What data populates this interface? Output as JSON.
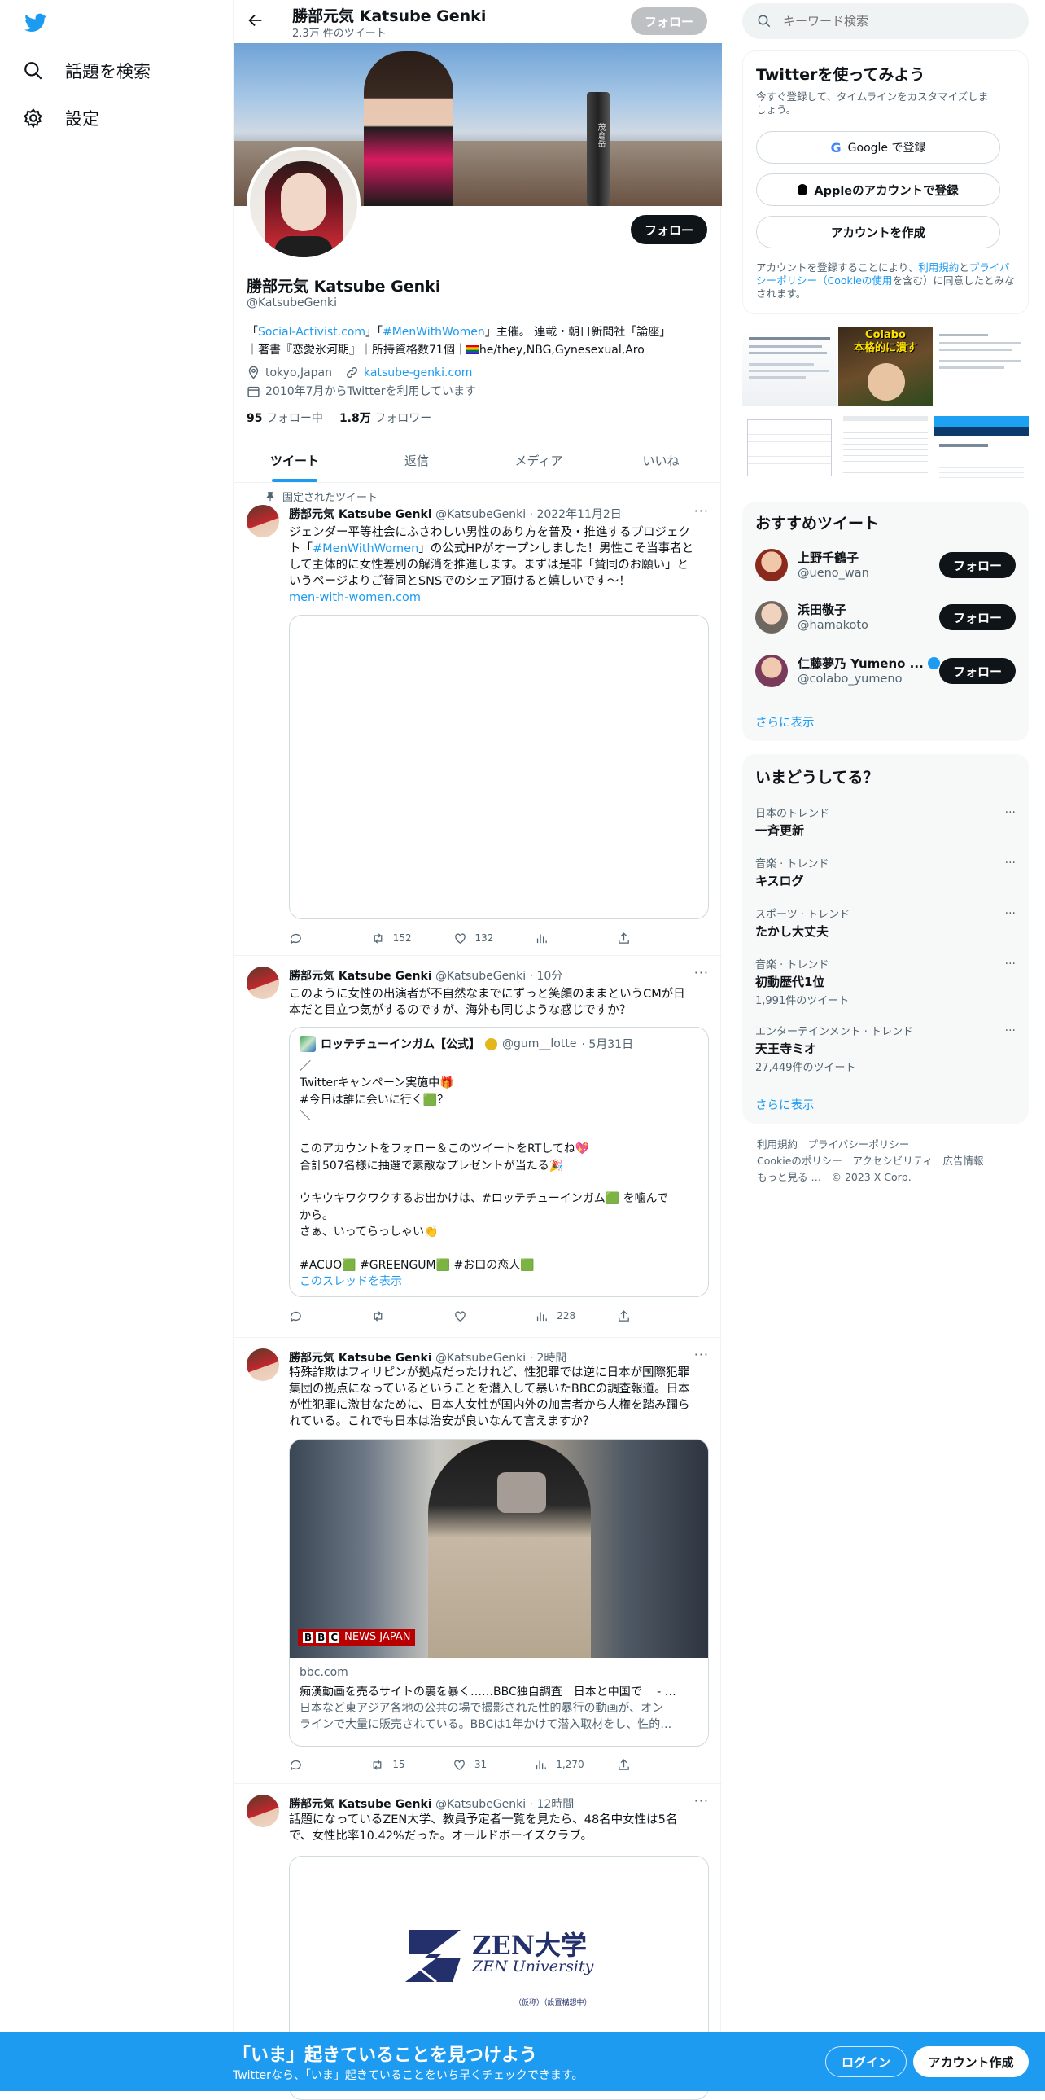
{
  "nav": {
    "explore_label": "話題を検索",
    "settings_label": "設定"
  },
  "header": {
    "name": "勝部元気 Katsube Genki",
    "tweet_count": "2.3万 件のツイート",
    "follow_label": "フォロー"
  },
  "profile": {
    "name": "勝部元気 Katsube Genki",
    "handle": "@KatsubeGenki",
    "bio_prefix": "「",
    "bio_link1": "Social-Activist.com",
    "bio_mid1": "」「",
    "bio_link2": "#MenWithWomen",
    "bio_rest1": "」主催。 連載・朝日新聞社「論座」",
    "bio_line2_a": "｜著書『恋愛氷河期』｜所持資格数71個｜",
    "bio_line2_b": "he/they,NBG,Gynesexual,Aro",
    "location": "tokyo,Japan",
    "website": "katsube-genki.com",
    "joined": "2010年7月からTwitterを利用しています",
    "following_count": "95",
    "following_label": "フォロー中",
    "followers_count": "1.8万",
    "followers_label": "フォロワー",
    "follow_label": "フォロー",
    "summit_sign": "茂倉岳"
  },
  "tabs": [
    "ツイート",
    "返信",
    "メディア",
    "いいね"
  ],
  "pinned_label": "固定されたツイート",
  "tweets": [
    {
      "name": "勝部元気 Katsube Genki",
      "handle": "@KatsubeGenki",
      "time": "· 2022年11月2日",
      "text_a": "ジェンダー平等社会にふさわしい男性のあり方を普及・推進するプロジェク\nト「",
      "text_link": "#MenWithWomen",
      "text_b": "」の公式HPがオープンしました！男性こそ当事者と\nして主体的に女性差別の解消を推進します。まずは是非「賛同のお願い」と\nいうページよりご賛同とSNSでのシェア頂けると嬉しいです〜！",
      "url": "men-with-women.com",
      "reply": "",
      "retweet": "152",
      "like": "132",
      "views": ""
    },
    {
      "name": "勝部元気 Katsube Genki",
      "handle": "@KatsubeGenki",
      "time": "· 10分",
      "text": "このように女性の出演者が不自然なまでにずっと笑顔のままというCMが日\n本だと目立つ気がするのですが、海外も同じような感じですか？",
      "quote": {
        "name": "ロッテチューインガム【公式】",
        "handle": "@gum__lotte",
        "time": "· 5月31日",
        "text": "／\nTwitterキャンペーン実施中🎁\n#今日は誰に会いに行く🟩？\n＼\n\nこのアカウントをフォロー＆このツイートをRTしてね💖\n合計507名様に抽選で素敵なプレゼントが当たる🎉\n\nウキウキワクワクするお出かけは、#ロッテチューインガム🟩 を噛んで\nから。\nさぁ、いってらっしゃい👏\n\n#ACUO🟩 #GREENGUM🟩 #お口の恋人🟩",
        "thread": "このスレッドを表示"
      },
      "reply": "",
      "retweet": "",
      "like": "",
      "views": "228"
    },
    {
      "name": "勝部元気 Katsube Genki",
      "handle": "@KatsubeGenki",
      "time": "· 2時間",
      "text": "特殊詐欺はフィリピンが拠点だったけれど、性犯罪では逆に日本が国際犯罪\n集団の拠点になっているということを潜入して暴いたBBCの調査報道。日本\nが性犯罪に激甘なために、日本人女性が国内外の加害者から人権を踏み躙ら\nれている。これでも日本は治安が良いなんて言えますか？",
      "card": {
        "brand": "NEWS JAPAN",
        "domain": "bbc.com",
        "title": "痴漢動画を売るサイトの裏を暴く……BBC独自調査　日本と中国で　 - …",
        "desc": "日本など東アジア各地の公共の場で撮影された性的暴行の動画が、オン\nラインで大量に販売されている。BBCは1年かけて潜入取材をし、性的…"
      },
      "reply": "",
      "retweet": "15",
      "like": "31",
      "views": "1,270"
    },
    {
      "name": "勝部元気 Katsube Genki",
      "handle": "@KatsubeGenki",
      "time": "· 12時間",
      "text": "話題になっているZEN大学、教員予定者一覧を見たら、48名中女性は5名\nで、女性比率10.42%だった。オールドボーイズクラブ。",
      "card": {
        "logo_title": "ZEN大学",
        "logo_sub": "ZEN University",
        "logo_note": "（仮称）（設置構想中）"
      }
    }
  ],
  "right": {
    "search_placeholder": "キーワード検索",
    "signup": {
      "title": "Twitterを使ってみよう",
      "subtitle": "今すぐ登録して、タイムラインをカスタマイズしま\nしょう。",
      "google": "Google で登録",
      "apple": "Appleのアカウントで登録",
      "create": "アカウントを作成",
      "terms_a": "アカウントを登録することにより、",
      "terms_link1": "利用規約",
      "terms_b": "と",
      "terms_link2": "プライバシーポリシー（Cookieの使用",
      "terms_c": "を含む）に同意したとみなされます。"
    },
    "media_thumb_text": "Colabo\n本格的に潰す",
    "recommended": {
      "title": "おすすめツイート",
      "users": [
        {
          "name": "上野千鶴子",
          "handle": "@ueno_wan",
          "follow": "フォロー"
        },
        {
          "name": "浜田敬子",
          "handle": "@hamakoto",
          "follow": "フォロー"
        },
        {
          "name": "仁藤夢乃 Yumeno ...",
          "handle": "@colabo_yumeno",
          "follow": "フォロー"
        }
      ],
      "more": "さらに表示"
    },
    "trends": {
      "title": "いまどうしてる？",
      "items": [
        {
          "category": "日本のトレンド",
          "name": "一斉更新",
          "count": ""
        },
        {
          "category": "音楽 · トレンド",
          "name": "キスログ",
          "count": ""
        },
        {
          "category": "スポーツ · トレンド",
          "name": "たかし大丈夫",
          "count": ""
        },
        {
          "category": "音楽 · トレンド",
          "name": "初動歴代1位",
          "count": "1,991件のツイート"
        },
        {
          "category": "エンターテインメント · トレンド",
          "name": "天王寺ミオ",
          "count": "27,449件のツイート"
        }
      ],
      "more": "さらに表示"
    },
    "footer": {
      "line1": "利用規約　プライバシーポリシー",
      "line2": "Cookieのポリシー　アクセシビリティ　広告情報",
      "line3": "もっと見る …　© 2023 X Corp."
    }
  },
  "bottombar": {
    "title": "「いま」起きていることを見つけよう",
    "subtitle": "Twitterなら、「いま」起きていることをいち早くチェックできます。",
    "login": "ログイン",
    "signup": "アカウント作成"
  },
  "colors": {
    "accent": "#1d9bf0",
    "text": "#0f1419",
    "secondary": "#536471"
  }
}
